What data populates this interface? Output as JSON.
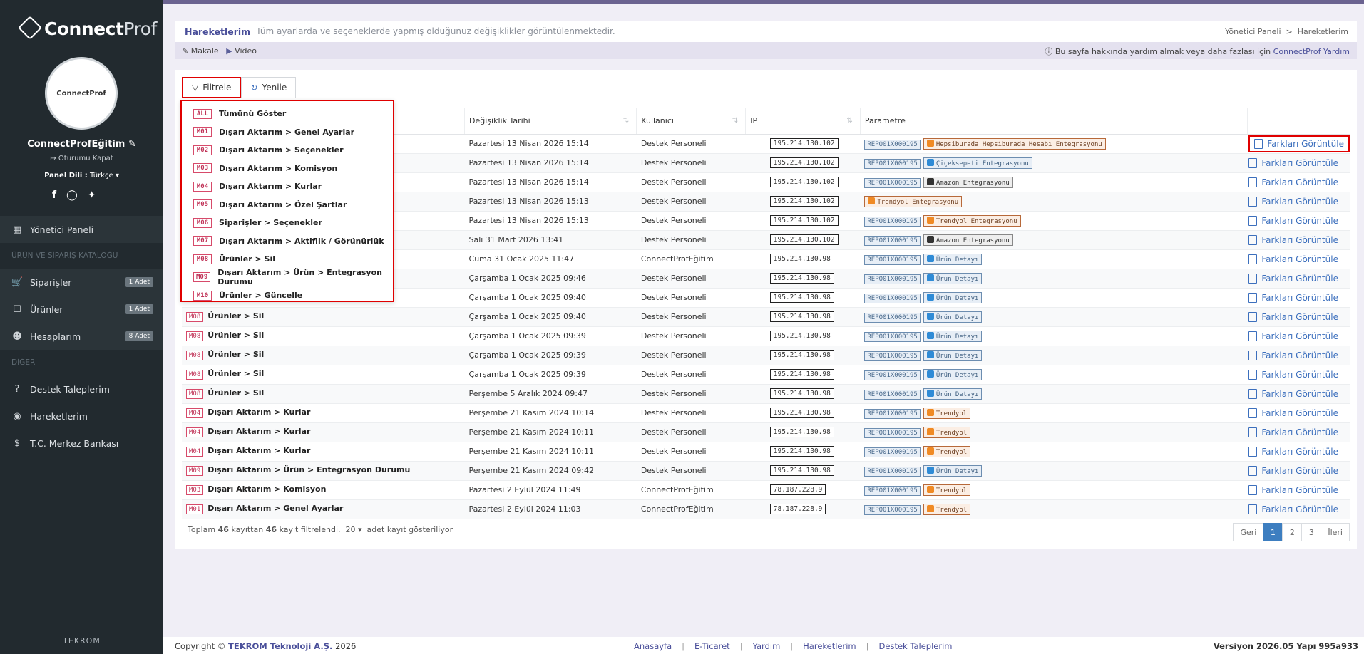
{
  "brand": {
    "logo_bold": "Connect",
    "logo_light": "Prof",
    "avatar_text": "ConnectProf"
  },
  "user": {
    "name": "ConnectProfEğitim",
    "logout": "Oturumu Kapat",
    "panel_lang_label": "Panel Dili :",
    "panel_lang_value": "Türkçe"
  },
  "nav": {
    "dashboard": "Yönetici Paneli",
    "section1": "ÜRÜN VE SİPARİŞ KATALOĞU",
    "orders": "Siparişler",
    "orders_badge": "1 Adet",
    "products": "Ürünler",
    "products_badge": "1 Adet",
    "accounts": "Hesaplarım",
    "accounts_badge": "8 Adet",
    "section2": "DİĞER",
    "support": "Destek Taleplerim",
    "activity": "Hareketlerim",
    "bank": "T.C. Merkez Bankası"
  },
  "tekrom": "TEKROM",
  "header": {
    "title": "Hareketlerim",
    "desc": "Tüm ayarlarda ve seçeneklerde yapmış olduğunuz değişiklikler görüntülenmektedir.",
    "crumb1": "Yönetici Paneli",
    "crumb_sep": ">",
    "crumb2": "Hareketlerim"
  },
  "subbar": {
    "article": "Makale",
    "video": "Video",
    "help_text": "Bu sayfa hakkında yardım almak veya daha fazlası için",
    "help_link": "ConnectProf Yardım"
  },
  "toolbar": {
    "filter": "Filtrele",
    "refresh": "Yenile"
  },
  "columns": {
    "date": "Değişiklik Tarihi",
    "user": "Kullanıcı",
    "ip": "IP",
    "param": "Parametre"
  },
  "dropdown": [
    {
      "code": "ALL",
      "label": "Tümünü Göster"
    },
    {
      "code": "M01",
      "label": "Dışarı Aktarım > Genel Ayarlar"
    },
    {
      "code": "M02",
      "label": "Dışarı Aktarım > Seçenekler"
    },
    {
      "code": "M03",
      "label": "Dışarı Aktarım > Komisyon"
    },
    {
      "code": "M04",
      "label": "Dışarı Aktarım > Kurlar"
    },
    {
      "code": "M05",
      "label": "Dışarı Aktarım > Özel Şartlar"
    },
    {
      "code": "M06",
      "label": "Siparişler > Seçenekler"
    },
    {
      "code": "M07",
      "label": "Dışarı Aktarım > Aktiflik / Görünürlük"
    },
    {
      "code": "M08",
      "label": "Ürünler > Sil"
    },
    {
      "code": "M09",
      "label": "Dışarı Aktarım > Ürün > Entegrasyon Durumu"
    },
    {
      "code": "M10",
      "label": "Ürünler > Güncelle"
    }
  ],
  "diff_label": "Farkları Görüntüle",
  "rows": [
    {
      "code": "",
      "op": "",
      "date": "Pazartesi 13 Nisan 2026 15:14",
      "user": "Destek Personeli",
      "ip": "195.214.130.102",
      "repo": "REPO01X000195",
      "param": "Hepsiburada Hepsiburada Hesabı Entegrasyonu",
      "ptype": "orange"
    },
    {
      "code": "",
      "op": "",
      "date": "Pazartesi 13 Nisan 2026 15:14",
      "user": "Destek Personeli",
      "ip": "195.214.130.102",
      "repo": "REPO01X000195",
      "param": "Çiçeksepeti Entegrasyonu",
      "ptype": "blue"
    },
    {
      "code": "",
      "op": "",
      "date": "Pazartesi 13 Nisan 2026 15:14",
      "user": "Destek Personeli",
      "ip": "195.214.130.102",
      "repo": "REPO01X000195",
      "param": "Amazon Entegrasyonu",
      "ptype": "gray"
    },
    {
      "code": "",
      "op": "",
      "date": "Pazartesi 13 Nisan 2026 15:13",
      "user": "Destek Personeli",
      "ip": "195.214.130.102",
      "repo": "",
      "param": "Trendyol Entegrasyonu",
      "ptype": "orange"
    },
    {
      "code": "",
      "op": "",
      "date": "Pazartesi 13 Nisan 2026 15:13",
      "user": "Destek Personeli",
      "ip": "195.214.130.102",
      "repo": "REPO01X000195",
      "param": "Trendyol Entegrasyonu",
      "ptype": "orange"
    },
    {
      "code": "",
      "op": "",
      "date": "Salı 31 Mart 2026 13:41",
      "user": "Destek Personeli",
      "ip": "195.214.130.102",
      "repo": "REPO01X000195",
      "param": "Amazon Entegrasyonu",
      "ptype": "gray"
    },
    {
      "code": "",
      "op": "",
      "date": "Cuma 31 Ocak 2025 11:47",
      "user": "ConnectProfEğitim",
      "ip": "195.214.130.98",
      "repo": "REPO01X000195",
      "param": "Ürün Detayı",
      "ptype": "blue"
    },
    {
      "code": "",
      "op": "",
      "date": "Çarşamba 1 Ocak 2025 09:46",
      "user": "Destek Personeli",
      "ip": "195.214.130.98",
      "repo": "REPO01X000195",
      "param": "Ürün Detayı",
      "ptype": "blue"
    },
    {
      "code": "",
      "op": "",
      "date": "Çarşamba 1 Ocak 2025 09:40",
      "user": "Destek Personeli",
      "ip": "195.214.130.98",
      "repo": "REPO01X000195",
      "param": "Ürün Detayı",
      "ptype": "blue"
    },
    {
      "code": "M08",
      "op": "Ürünler > Sil",
      "date": "Çarşamba 1 Ocak 2025 09:40",
      "user": "Destek Personeli",
      "ip": "195.214.130.98",
      "repo": "REPO01X000195",
      "param": "Ürün Detayı",
      "ptype": "blue"
    },
    {
      "code": "M08",
      "op": "Ürünler > Sil",
      "date": "Çarşamba 1 Ocak 2025 09:39",
      "user": "Destek Personeli",
      "ip": "195.214.130.98",
      "repo": "REPO01X000195",
      "param": "Ürün Detayı",
      "ptype": "blue"
    },
    {
      "code": "M08",
      "op": "Ürünler > Sil",
      "date": "Çarşamba 1 Ocak 2025 09:39",
      "user": "Destek Personeli",
      "ip": "195.214.130.98",
      "repo": "REPO01X000195",
      "param": "Ürün Detayı",
      "ptype": "blue"
    },
    {
      "code": "M08",
      "op": "Ürünler > Sil",
      "date": "Çarşamba 1 Ocak 2025 09:39",
      "user": "Destek Personeli",
      "ip": "195.214.130.98",
      "repo": "REPO01X000195",
      "param": "Ürün Detayı",
      "ptype": "blue"
    },
    {
      "code": "M08",
      "op": "Ürünler > Sil",
      "date": "Perşembe 5 Aralık 2024 09:47",
      "user": "Destek Personeli",
      "ip": "195.214.130.98",
      "repo": "REPO01X000195",
      "param": "Ürün Detayı",
      "ptype": "blue"
    },
    {
      "code": "M04",
      "op": "Dışarı Aktarım > Kurlar",
      "date": "Perşembe 21 Kasım 2024 10:14",
      "user": "Destek Personeli",
      "ip": "195.214.130.98",
      "repo": "REPO01X000195",
      "param": "Trendyol",
      "ptype": "orange"
    },
    {
      "code": "M04",
      "op": "Dışarı Aktarım > Kurlar",
      "date": "Perşembe 21 Kasım 2024 10:11",
      "user": "Destek Personeli",
      "ip": "195.214.130.98",
      "repo": "REPO01X000195",
      "param": "Trendyol",
      "ptype": "orange"
    },
    {
      "code": "M04",
      "op": "Dışarı Aktarım > Kurlar",
      "date": "Perşembe 21 Kasım 2024 10:11",
      "user": "Destek Personeli",
      "ip": "195.214.130.98",
      "repo": "REPO01X000195",
      "param": "Trendyol",
      "ptype": "orange"
    },
    {
      "code": "M09",
      "op": "Dışarı Aktarım > Ürün > Entegrasyon Durumu",
      "date": "Perşembe 21 Kasım 2024 09:42",
      "user": "Destek Personeli",
      "ip": "195.214.130.98",
      "repo": "REPO01X000195",
      "param": "Ürün Detayı",
      "ptype": "blue"
    },
    {
      "code": "M03",
      "op": "Dışarı Aktarım > Komisyon",
      "date": "Pazartesi 2 Eylül 2024 11:49",
      "user": "ConnectProfEğitim",
      "ip": "78.187.228.9",
      "repo": "REPO01X000195",
      "param": "Trendyol",
      "ptype": "orange"
    },
    {
      "code": "M01",
      "op": "Dışarı Aktarım > Genel Ayarlar",
      "date": "Pazartesi 2 Eylül 2024 11:03",
      "user": "ConnectProfEğitim",
      "ip": "78.187.228.9",
      "repo": "REPO01X000195",
      "param": "Trendyol",
      "ptype": "orange"
    }
  ],
  "summary": {
    "pre": "Toplam",
    "total": "46",
    "mid": "kayıttan",
    "filtered": "46",
    "post": "kayıt filtrelendi.",
    "page_size": "20",
    "show": "adet kayıt gösteriliyor"
  },
  "pager": {
    "prev": "Geri",
    "p1": "1",
    "p2": "2",
    "p3": "3",
    "next": "İleri"
  },
  "footer": {
    "copy": "Copyright ©",
    "company": "TEKROM Teknoloji A.Ş.",
    "year": "2026",
    "links": [
      "Anasayfa",
      "E-Ticaret",
      "Yardım",
      "Hareketlerim",
      "Destek Taleplerim"
    ],
    "version_label": "Versiyon 2026.05 Yapı",
    "build": "995a933"
  }
}
